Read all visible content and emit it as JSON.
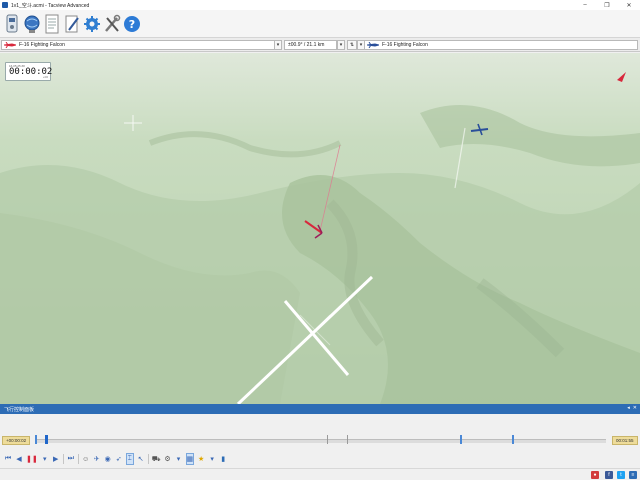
{
  "window": {
    "title": "1v1_空斗.acmi - Tacview Advanced",
    "minimize": "–",
    "maximize": "❐",
    "close": "✕"
  },
  "toolbar": {
    "buttons": [
      "recorder-icon",
      "globe-icon",
      "document-icon",
      "edit-icon",
      "settings-icon",
      "tools-icon",
      "help-icon"
    ]
  },
  "selection": {
    "primary_object": "F-16 Fighting Falcon",
    "relative_info": "±00.9° / 21.1 km",
    "secondary_object": "F-16 Fighting Falcon"
  },
  "clock": {
    "date": "16.05.25 ##",
    "time": "00:00:02",
    "utc": "+00"
  },
  "panel": {
    "title": "飞行控制面板",
    "pin": "◂",
    "close": "✕"
  },
  "timeline": {
    "start_time": "+00:00:02",
    "end_time": "00:01:55"
  },
  "colors": {
    "accent": "#2d6cb5",
    "terrain": "#bcd2b2",
    "red_jet": "#d8283c",
    "blue_jet": "#2a4f9a"
  }
}
